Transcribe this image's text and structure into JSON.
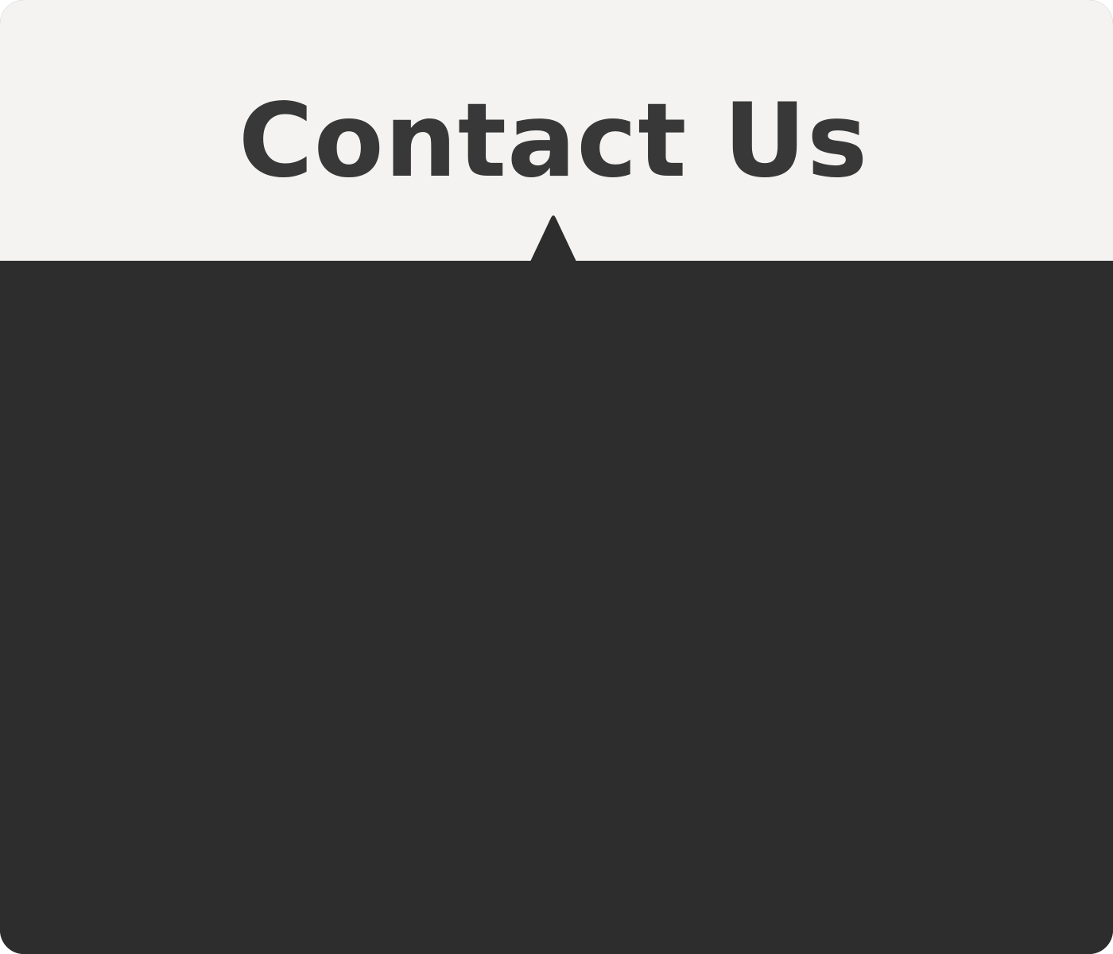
{
  "header": {
    "title": "Contact Us"
  },
  "colors": {
    "header_background": "#f4f3f1",
    "title_text": "#383838",
    "panel_background": "#2d2d2d"
  },
  "icons": {
    "pointer": "caret-up-icon"
  }
}
